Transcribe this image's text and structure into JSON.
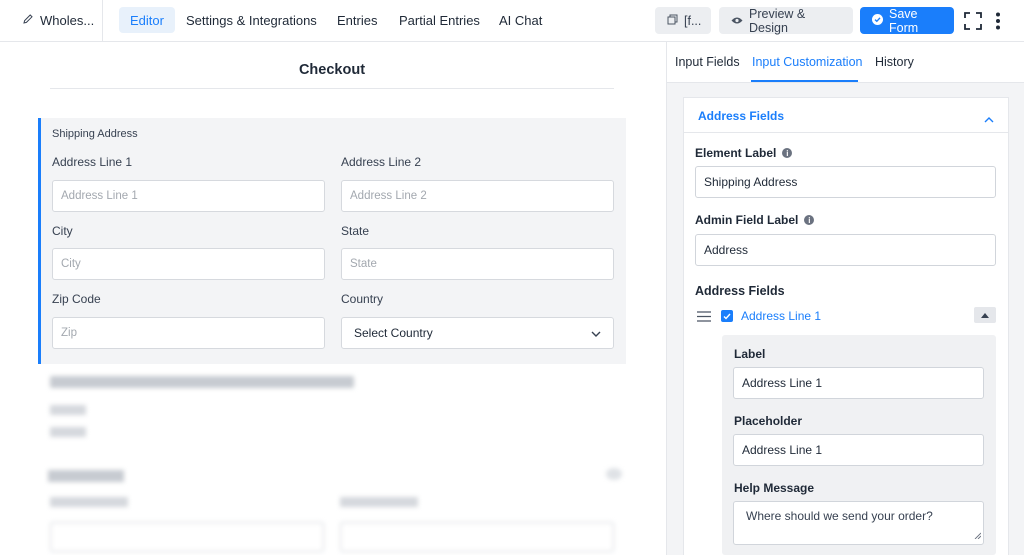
{
  "topbar": {
    "form_name": "Wholes...",
    "tabs": [
      "Editor",
      "Settings & Integrations",
      "Entries",
      "Partial Entries",
      "AI Chat"
    ],
    "active_tab": "Editor",
    "shortcode_label": "[f...",
    "preview_label": "Preview & Design",
    "save_label": "Save Form"
  },
  "canvas": {
    "form_title": "Checkout",
    "section_title": "Shipping Address",
    "fields": [
      {
        "label": "Address Line 1",
        "placeholder": "Address Line 1"
      },
      {
        "label": "Address Line 2",
        "placeholder": "Address Line 2"
      },
      {
        "label": "City",
        "placeholder": "City"
      },
      {
        "label": "State",
        "placeholder": "State"
      },
      {
        "label": "Zip Code",
        "placeholder": "Zip"
      },
      {
        "label": "Country",
        "value": "Select Country"
      }
    ]
  },
  "panel": {
    "tabs": [
      "Input Fields",
      "Input Customization",
      "History"
    ],
    "active_tab": "Input Customization",
    "card_title": "Address Fields",
    "element_label": {
      "label": "Element Label",
      "value": "Shipping Address"
    },
    "admin_label": {
      "label": "Admin Field Label",
      "value": "Address"
    },
    "address_fields_heading": "Address Fields",
    "address_item": {
      "name": "Address Line 1",
      "checked": true
    },
    "sub": {
      "label_title": "Label",
      "label_value": "Address Line 1",
      "placeholder_title": "Placeholder",
      "placeholder_value": "Address Line 1",
      "help_title": "Help Message",
      "help_value": "Where should we send your order?"
    }
  },
  "colors": {
    "accent": "#1a7efb",
    "section_bg": "#f3f4f6"
  }
}
